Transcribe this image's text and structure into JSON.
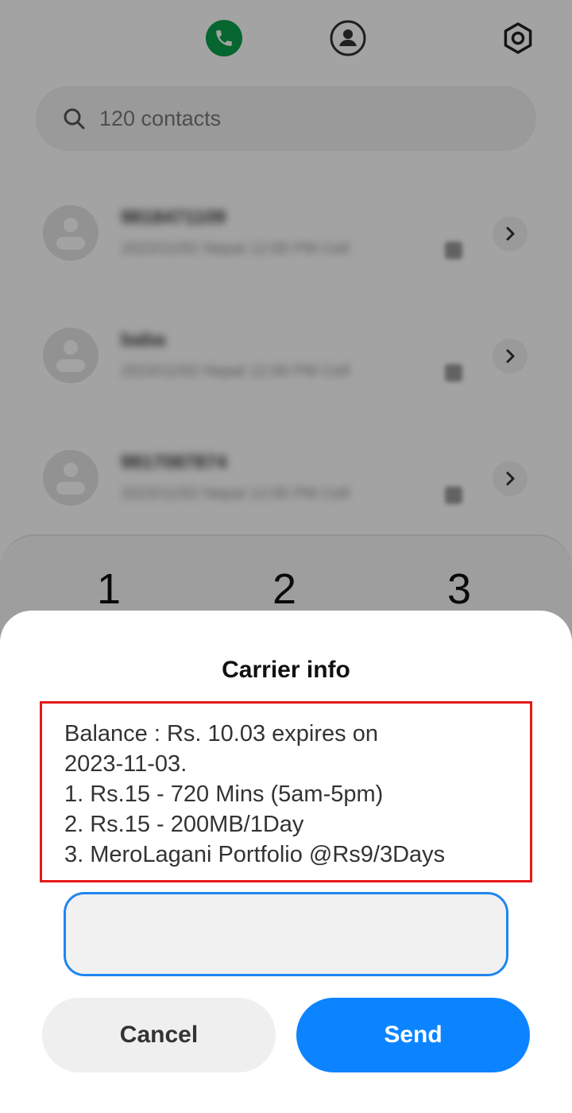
{
  "top_tabs": {
    "phone_icon": "phone-icon",
    "contacts_icon": "person-icon",
    "settings_icon": "gear-icon"
  },
  "search": {
    "icon": "search-icon",
    "text": "120 contacts"
  },
  "call_log": [
    {
      "name": "9818471109",
      "detail": "2023/11/02 Nepal 12:00 PM Cell",
      "chevron": "chevron-right-icon"
    },
    {
      "name": "baba",
      "detail": "2023/11/02 Nepal 12:00 PM Cell",
      "chevron": "chevron-right-icon"
    },
    {
      "name": "9817087874",
      "detail": "2023/11/02 Nepal 12:00 PM Cell",
      "chevron": "chevron-right-icon"
    }
  ],
  "dialpad": {
    "keys": [
      "1",
      "2",
      "3"
    ]
  },
  "dialog": {
    "title": "Carrier info",
    "message_lines": [
      "Balance : Rs. 10.03 expires on",
      "2023-11-03.",
      "1. Rs.15 - 720 Mins (5am-5pm)",
      "2. Rs.15 - 200MB/1Day",
      "3. MeroLagani Portfolio @Rs9/3Days"
    ],
    "reply_value": "",
    "cancel_label": "Cancel",
    "send_label": "Send"
  },
  "colors": {
    "accent": "#0d84ff",
    "call_green": "#0aa04a",
    "highlight_border": "#e31919"
  }
}
